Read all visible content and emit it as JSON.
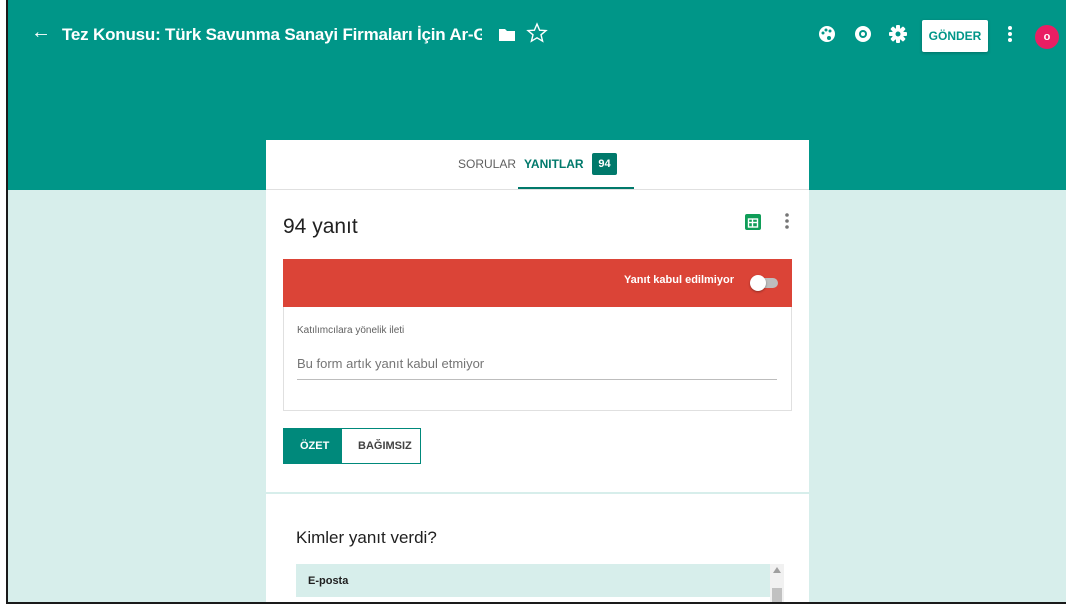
{
  "header": {
    "title": "Tez Konusu: Türk Savunma Sanayi Firmaları İçin Ar-Ge Performans",
    "send_label": "GÖNDER",
    "avatar_initial": "o",
    "colors": {
      "header_bg": "#009688",
      "avatar": "#e91e63"
    },
    "icons": [
      "back-arrow-icon",
      "folder-icon",
      "star-icon",
      "palette-icon",
      "eye-icon",
      "gear-icon",
      "more-vert-icon"
    ]
  },
  "tabs": {
    "questions": "SORULAR",
    "responses": "YANITLAR",
    "responses_count": "94",
    "active": "YANITLAR"
  },
  "responses": {
    "count_label": "94 yanıt",
    "banner_label": "Yanıt kabul edilmiyor",
    "accepting": false,
    "message_label": "Katılımcılara yönelik ileti",
    "message_placeholder": "Bu form artık yanıt kabul etmiyor",
    "colors": {
      "banner": "#db4437",
      "accent": "#00897b"
    }
  },
  "view_toggle": {
    "summary": "ÖZET",
    "individual": "BAĞIMSIZ",
    "selected": "ÖZET"
  },
  "who_responded": {
    "title": "Kimler yanıt verdi?",
    "column_header": "E-posta"
  }
}
